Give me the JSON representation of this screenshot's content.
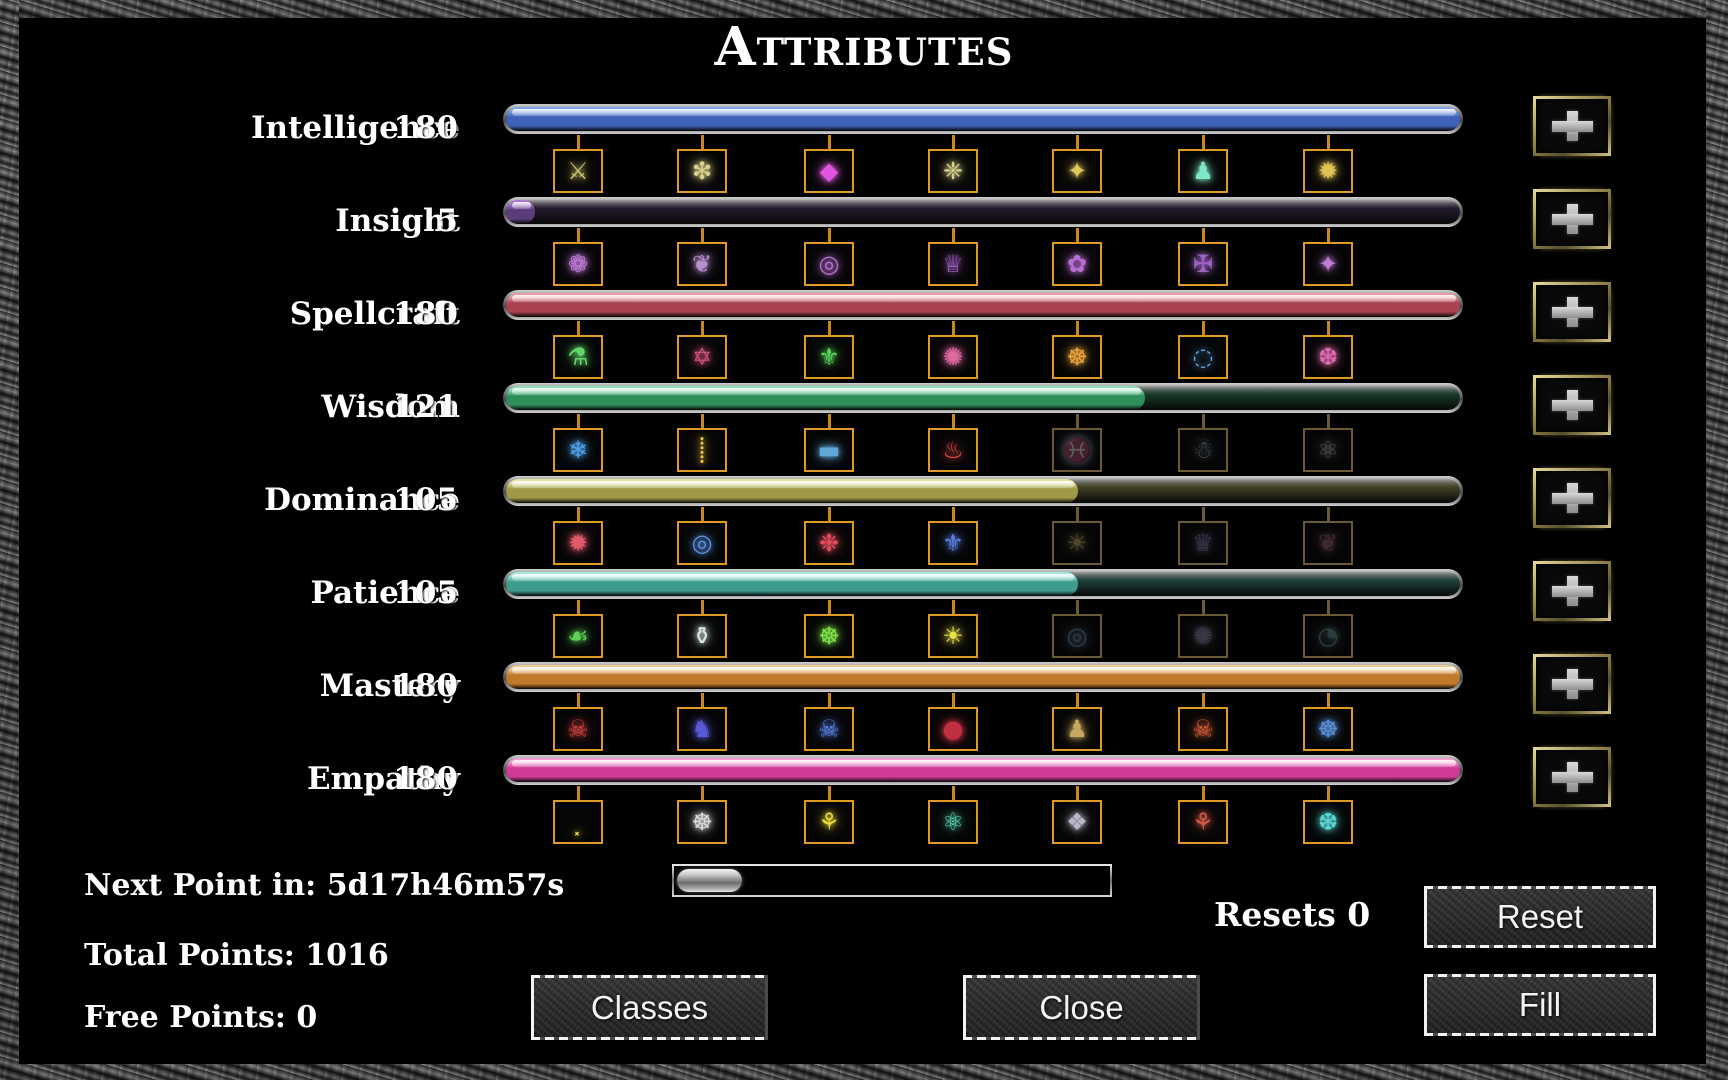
{
  "window": {
    "title": "Attributes"
  },
  "attributes": [
    {
      "name": "Intelligence",
      "value": "180",
      "fill_percent": 100,
      "color": "#3f63b8",
      "color_light": "#7fa2e8",
      "icons": [
        {
          "glyph": "⚔",
          "color": "#c9c06a",
          "locked": false,
          "name": "icon-int-1"
        },
        {
          "glyph": "❇",
          "color": "#d8d28a",
          "locked": false,
          "name": "icon-int-2"
        },
        {
          "glyph": "◆",
          "color": "#e055e0",
          "locked": false,
          "name": "icon-int-3"
        },
        {
          "glyph": "❈",
          "color": "#d8d28a",
          "locked": false,
          "name": "icon-int-4"
        },
        {
          "glyph": "✦",
          "color": "#e2c95c",
          "locked": false,
          "name": "icon-int-5"
        },
        {
          "glyph": "♟",
          "color": "#7fe6c8",
          "locked": false,
          "name": "icon-int-6"
        },
        {
          "glyph": "✹",
          "color": "#e0c451",
          "locked": false,
          "name": "icon-int-7"
        }
      ]
    },
    {
      "name": "Insight",
      "value": "5",
      "fill_percent": 3,
      "color": "#5a3d78",
      "color_light": "#a878d8",
      "icons": [
        {
          "glyph": "❁",
          "color": "#c07ad8",
          "locked": false,
          "name": "icon-ins-1"
        },
        {
          "glyph": "❦",
          "color": "#b98fd0",
          "locked": false,
          "name": "icon-ins-2"
        },
        {
          "glyph": "◎",
          "color": "#b86fd4",
          "locked": false,
          "name": "icon-ins-3"
        },
        {
          "glyph": "♕",
          "color": "#a862c8",
          "locked": false,
          "name": "icon-ins-4"
        },
        {
          "glyph": "✿",
          "color": "#b86fd4",
          "locked": false,
          "name": "icon-ins-5"
        },
        {
          "glyph": "✠",
          "color": "#9e63c4",
          "locked": false,
          "name": "icon-ins-6"
        },
        {
          "glyph": "✦",
          "color": "#c07ad8",
          "locked": false,
          "name": "icon-ins-7"
        }
      ]
    },
    {
      "name": "Spellcraft",
      "value": "180",
      "fill_percent": 100,
      "color": "#a8434f",
      "color_light": "#e89aa4",
      "icons": [
        {
          "glyph": "⚗",
          "color": "#62d86a",
          "locked": false,
          "name": "icon-spl-1"
        },
        {
          "glyph": "✡",
          "color": "#d0537d",
          "locked": false,
          "name": "icon-spl-2"
        },
        {
          "glyph": "⚜",
          "color": "#5ad45a",
          "locked": false,
          "name": "icon-spl-3"
        },
        {
          "glyph": "✺",
          "color": "#e06aa0",
          "locked": false,
          "name": "icon-spl-4"
        },
        {
          "glyph": "☸",
          "color": "#e8a13c",
          "locked": false,
          "name": "icon-spl-5"
        },
        {
          "glyph": "◌",
          "color": "#5fa8e8",
          "locked": false,
          "name": "icon-spl-6"
        },
        {
          "glyph": "❆",
          "color": "#e06ab0",
          "locked": false,
          "name": "icon-spl-7"
        }
      ]
    },
    {
      "name": "Wisdom",
      "value": "121",
      "fill_percent": 67,
      "color": "#2f8f5c",
      "color_light": "#8fe0b4",
      "icons": [
        {
          "glyph": "❄",
          "color": "#4f9fe8",
          "locked": false,
          "name": "icon-wis-1"
        },
        {
          "glyph": "⸽",
          "color": "#e8c24c",
          "locked": false,
          "name": "icon-wis-2"
        },
        {
          "glyph": "▬",
          "color": "#5fa8d8",
          "locked": false,
          "name": "icon-wis-3"
        },
        {
          "glyph": "♨",
          "color": "#e04a4a",
          "locked": false,
          "name": "icon-wis-4"
        },
        {
          "glyph": "♓",
          "color": "#6fb8e0",
          "locked": true,
          "name": "icon-wis-5"
        },
        {
          "glyph": "☃",
          "color": "#8fc8e8",
          "locked": true,
          "name": "icon-wis-6"
        },
        {
          "glyph": "⚛",
          "color": "#c8c8c8",
          "locked": true,
          "name": "icon-wis-7"
        }
      ]
    },
    {
      "name": "Dominance",
      "value": "105",
      "fill_percent": 60,
      "color": "#a09a47",
      "color_light": "#e8e2a0",
      "icons": [
        {
          "glyph": "✹",
          "color": "#e05a6a",
          "locked": false,
          "name": "icon-dom-1"
        },
        {
          "glyph": "◎",
          "color": "#5a8fe0",
          "locked": false,
          "name": "icon-dom-2"
        },
        {
          "glyph": "❉",
          "color": "#e04a5a",
          "locked": false,
          "name": "icon-dom-3"
        },
        {
          "glyph": "⚜",
          "color": "#5a7fe0",
          "locked": false,
          "name": "icon-dom-4"
        },
        {
          "glyph": "☀",
          "color": "#e8b83c",
          "locked": true,
          "name": "icon-dom-5"
        },
        {
          "glyph": "♛",
          "color": "#8f6fe0",
          "locked": true,
          "name": "icon-dom-6"
        },
        {
          "glyph": "❦",
          "color": "#c05a8f",
          "locked": true,
          "name": "icon-dom-7"
        }
      ]
    },
    {
      "name": "Patience",
      "value": "105",
      "fill_percent": 60,
      "color": "#3f9d8f",
      "color_light": "#a0e8dc",
      "icons": [
        {
          "glyph": "☙",
          "color": "#5fd05a",
          "locked": false,
          "name": "icon-pat-1"
        },
        {
          "glyph": "⚱",
          "color": "#d8e8e0",
          "locked": false,
          "name": "icon-pat-2"
        },
        {
          "glyph": "☸",
          "color": "#7fe04a",
          "locked": false,
          "name": "icon-pat-3"
        },
        {
          "glyph": "☀",
          "color": "#e8e04c",
          "locked": false,
          "name": "icon-pat-4"
        },
        {
          "glyph": "◎",
          "color": "#4fa8d8",
          "locked": true,
          "name": "icon-pat-5"
        },
        {
          "glyph": "✺",
          "color": "#8f8fd8",
          "locked": true,
          "name": "icon-pat-6"
        },
        {
          "glyph": "◔",
          "color": "#4fa8b8",
          "locked": true,
          "name": "icon-pat-7"
        }
      ]
    },
    {
      "name": "Mastery",
      "value": "180",
      "fill_percent": 100,
      "color": "#c07a2a",
      "color_light": "#f0c88a",
      "icons": [
        {
          "glyph": "☠",
          "color": "#d04040",
          "locked": false,
          "name": "icon-mas-1"
        },
        {
          "glyph": "♞",
          "color": "#5a5ad8",
          "locked": false,
          "name": "icon-mas-2"
        },
        {
          "glyph": "☠",
          "color": "#5a7fe8",
          "locked": false,
          "name": "icon-mas-3"
        },
        {
          "glyph": "●",
          "color": "#c03040",
          "locked": false,
          "name": "icon-mas-4"
        },
        {
          "glyph": "♟",
          "color": "#c8a860",
          "locked": false,
          "name": "icon-mas-5"
        },
        {
          "glyph": "☠",
          "color": "#d05a3a",
          "locked": false,
          "name": "icon-mas-6"
        },
        {
          "glyph": "☸",
          "color": "#5a8fd8",
          "locked": false,
          "name": "icon-mas-7"
        }
      ]
    },
    {
      "name": "Empathy",
      "value": "180",
      "fill_percent": 100,
      "color": "#cf3b96",
      "color_light": "#f79fd4",
      "icons": [
        {
          "glyph": "⸼",
          "color": "#e8d84c",
          "locked": false,
          "name": "icon-emp-1"
        },
        {
          "glyph": "☸",
          "color": "#d8d8d8",
          "locked": false,
          "name": "icon-emp-2"
        },
        {
          "glyph": "⚘",
          "color": "#e8d83c",
          "locked": false,
          "name": "icon-emp-3"
        },
        {
          "glyph": "⚛",
          "color": "#5ad8b8",
          "locked": false,
          "name": "icon-emp-4"
        },
        {
          "glyph": "❖",
          "color": "#b8b8c8",
          "locked": false,
          "name": "icon-emp-5"
        },
        {
          "glyph": "⚘",
          "color": "#d05a4a",
          "locked": false,
          "name": "icon-emp-6"
        },
        {
          "glyph": "❆",
          "color": "#5ad8d8",
          "locked": false,
          "name": "icon-emp-7"
        }
      ]
    }
  ],
  "footer": {
    "next_point_label": "Next Point in: 5d17h46m57s",
    "total_points_label": "Total Points:  1016",
    "free_points_label": "Free Points:  0",
    "resets_label": "Resets 0",
    "xp_percent": 15
  },
  "buttons": {
    "classes": "Classes",
    "close": "Close",
    "reset": "Reset",
    "fill": "Fill"
  },
  "plus_button_count": 8
}
